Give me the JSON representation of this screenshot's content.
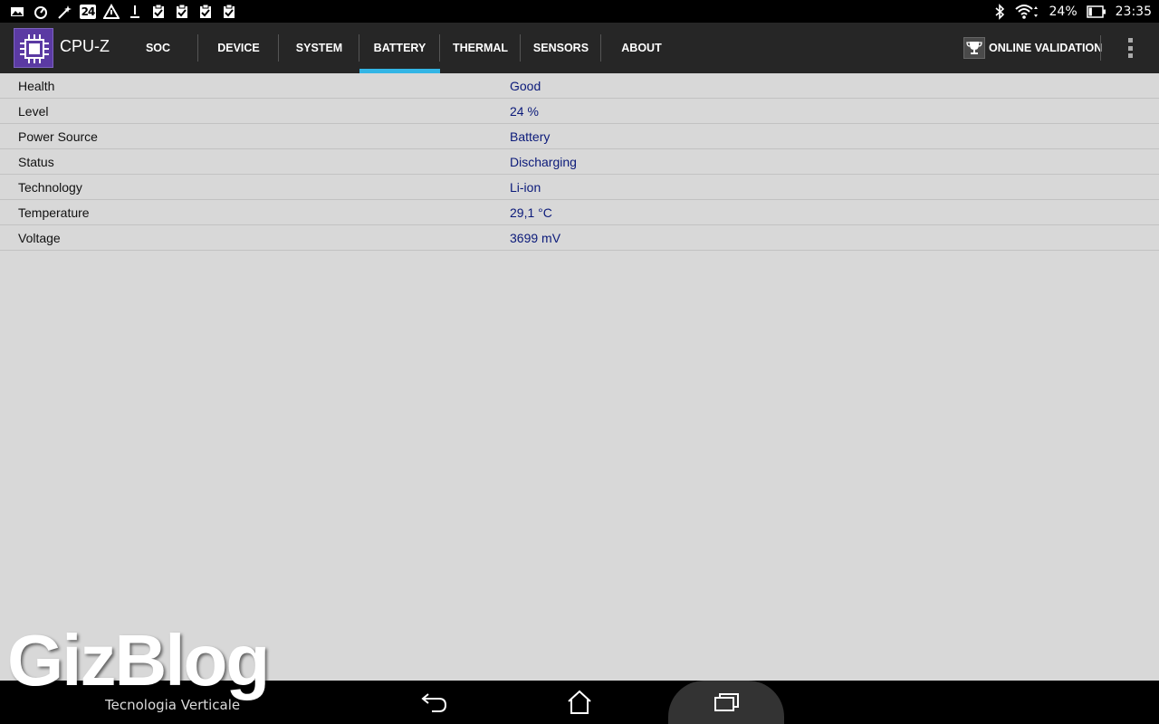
{
  "status_bar": {
    "left_icons": [
      "gallery-icon",
      "speedometer-icon",
      "magic-wand-icon",
      "24-badge-icon",
      "triangle-icon",
      "download-icon",
      "clipboard-check-icon",
      "clipboard-check-icon",
      "clipboard-check-icon",
      "clipboard-check-icon"
    ],
    "badge_24": "24",
    "battery_percent": "24%",
    "battery_level": 0.24,
    "time": "23:35"
  },
  "app": {
    "title": "CPU-Z"
  },
  "tabs": [
    {
      "label": "SOC",
      "active": false
    },
    {
      "label": "DEVICE",
      "active": false
    },
    {
      "label": "SYSTEM",
      "active": false
    },
    {
      "label": "BATTERY",
      "active": true
    },
    {
      "label": "THERMAL",
      "active": false
    },
    {
      "label": "SENSORS",
      "active": false
    },
    {
      "label": "ABOUT",
      "active": false
    }
  ],
  "actions": {
    "validation_label": "ONLINE VALIDATION"
  },
  "battery": {
    "rows": [
      {
        "label": "Health",
        "value": "Good"
      },
      {
        "label": "Level",
        "value": "24 %"
      },
      {
        "label": "Power Source",
        "value": "Battery"
      },
      {
        "label": "Status",
        "value": "Discharging"
      },
      {
        "label": "Technology",
        "value": "Li-ion"
      },
      {
        "label": "Temperature",
        "value": "29,1 °C"
      },
      {
        "label": "Voltage",
        "value": "3699 mV"
      }
    ]
  },
  "watermark": {
    "brand": "GizBlog",
    "tagline": "Tecnologia Verticale"
  },
  "colors": {
    "accent": "#33b5e5",
    "value_text": "#0b1a7a",
    "background": "#d8d8d8",
    "action_bar": "#262626"
  }
}
